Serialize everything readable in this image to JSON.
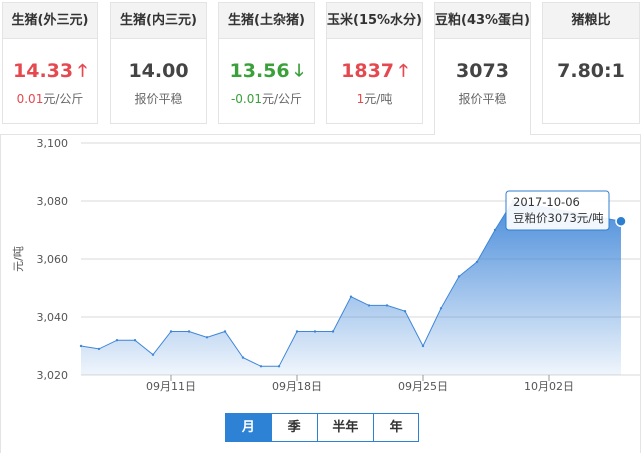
{
  "cards": [
    {
      "title": "生猪(外三元)",
      "price": "14.33",
      "change": "0.01",
      "unit": "元/公斤",
      "trend": "up"
    },
    {
      "title": "生猪(内三元)",
      "price": "14.00",
      "change": "报价平稳",
      "unit": "",
      "trend": "flat"
    },
    {
      "title": "生猪(土杂猪)",
      "price": "13.56",
      "change": "-0.01",
      "unit": "元/公斤",
      "trend": "down"
    },
    {
      "title": "玉米(15%水分)",
      "price": "1837",
      "change": "1",
      "unit": "元/吨",
      "trend": "up"
    },
    {
      "title": "豆粕(43%蛋白)",
      "price": "3073",
      "change": "报价平稳",
      "unit": "",
      "trend": "flat"
    },
    {
      "title": "猪粮比",
      "price": "7.80:1",
      "change": "",
      "unit": "",
      "trend": "none"
    }
  ],
  "chart_data": {
    "type": "area",
    "ylabel": "元/吨",
    "ylim": [
      3020,
      3100
    ],
    "yticks": [
      "3,100",
      "3,080",
      "3,060",
      "3,040",
      "3,020"
    ],
    "ytick_values": [
      3100,
      3080,
      3060,
      3040,
      3020
    ],
    "xtick_labels": [
      "09月11日",
      "09月18日",
      "09月25日",
      "10月02日"
    ],
    "xtick_days": [
      "2017-09-11",
      "2017-09-18",
      "2017-09-25",
      "2017-10-02"
    ],
    "x": [
      "2017-09-06",
      "2017-09-07",
      "2017-09-08",
      "2017-09-09",
      "2017-09-10",
      "2017-09-11",
      "2017-09-12",
      "2017-09-13",
      "2017-09-14",
      "2017-09-15",
      "2017-09-16",
      "2017-09-17",
      "2017-09-18",
      "2017-09-19",
      "2017-09-20",
      "2017-09-21",
      "2017-09-22",
      "2017-09-23",
      "2017-09-24",
      "2017-09-25",
      "2017-09-26",
      "2017-09-27",
      "2017-09-28",
      "2017-09-29",
      "2017-09-30",
      "2017-10-06"
    ],
    "series": [
      {
        "values": [
          3030,
          3029,
          3032,
          3032,
          3027,
          3035,
          3035,
          3033,
          3035,
          3026,
          3023,
          3023,
          3035,
          3035,
          3035,
          3047,
          3044,
          3044,
          3042,
          3030,
          3043,
          3054,
          3059,
          3070,
          3080,
          3073
        ]
      }
    ],
    "grid": true,
    "line_color": "#3f86d8",
    "tooltip": {
      "date": "2017-10-06",
      "label": "豆粕价3073元/吨"
    }
  },
  "tabs": [
    {
      "label": "月",
      "active": true
    },
    {
      "label": "季",
      "active": false
    },
    {
      "label": "半年",
      "active": false
    },
    {
      "label": "年",
      "active": false
    }
  ]
}
